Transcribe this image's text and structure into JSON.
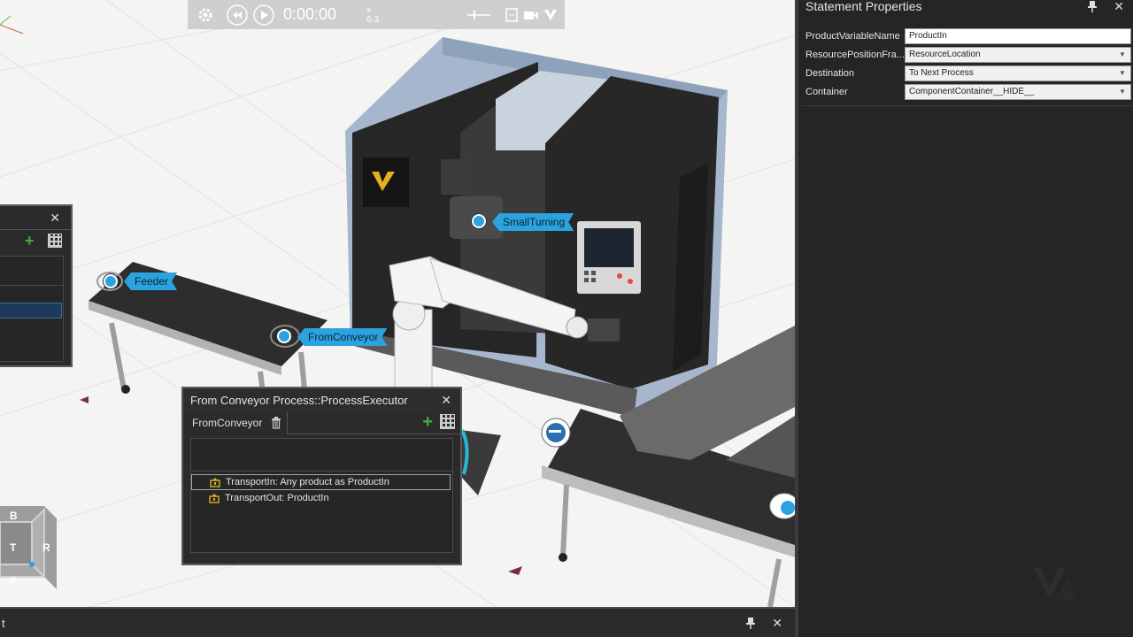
{
  "toolbar": {
    "time": "0:00:00",
    "speed": "x 6.3"
  },
  "scene_labels": {
    "small_turning": "SmallTurning",
    "feeder": "Feeder",
    "from_conveyor": "FromConveyor"
  },
  "process_panel": {
    "title": "From Conveyor Process::ProcessExecutor",
    "tab_label": "FromConveyor",
    "statements": [
      "TransportIn: Any product as ProductIn",
      "TransportOut: ProductIn"
    ]
  },
  "viewcube": {
    "back": "B",
    "top": "T",
    "right": "R",
    "front": "F"
  },
  "bottom_panel": {
    "title": "t"
  },
  "properties": {
    "title": "Statement Properties",
    "rows": [
      {
        "label": "ProductVariableName",
        "value": "ProductIn",
        "dropdown": false
      },
      {
        "label": "ResourcePositionFra...",
        "value": "ResourceLocation",
        "dropdown": true
      },
      {
        "label": "Destination",
        "value": "To Next Process",
        "dropdown": true
      },
      {
        "label": "Container",
        "value": "ComponentContainer__HIDE__",
        "dropdown": true
      }
    ]
  },
  "colors": {
    "accent": "#2aa3e0",
    "panel_bg": "#2b2b2b",
    "add_green": "#3cb043"
  },
  "icons": [
    "gear-icon",
    "rewind-icon",
    "play-icon",
    "slider-icon",
    "export-icon",
    "camera-icon",
    "logo-icon",
    "close-icon",
    "pin-icon",
    "add-icon",
    "grid-icon",
    "trash-icon",
    "statement-icon"
  ]
}
